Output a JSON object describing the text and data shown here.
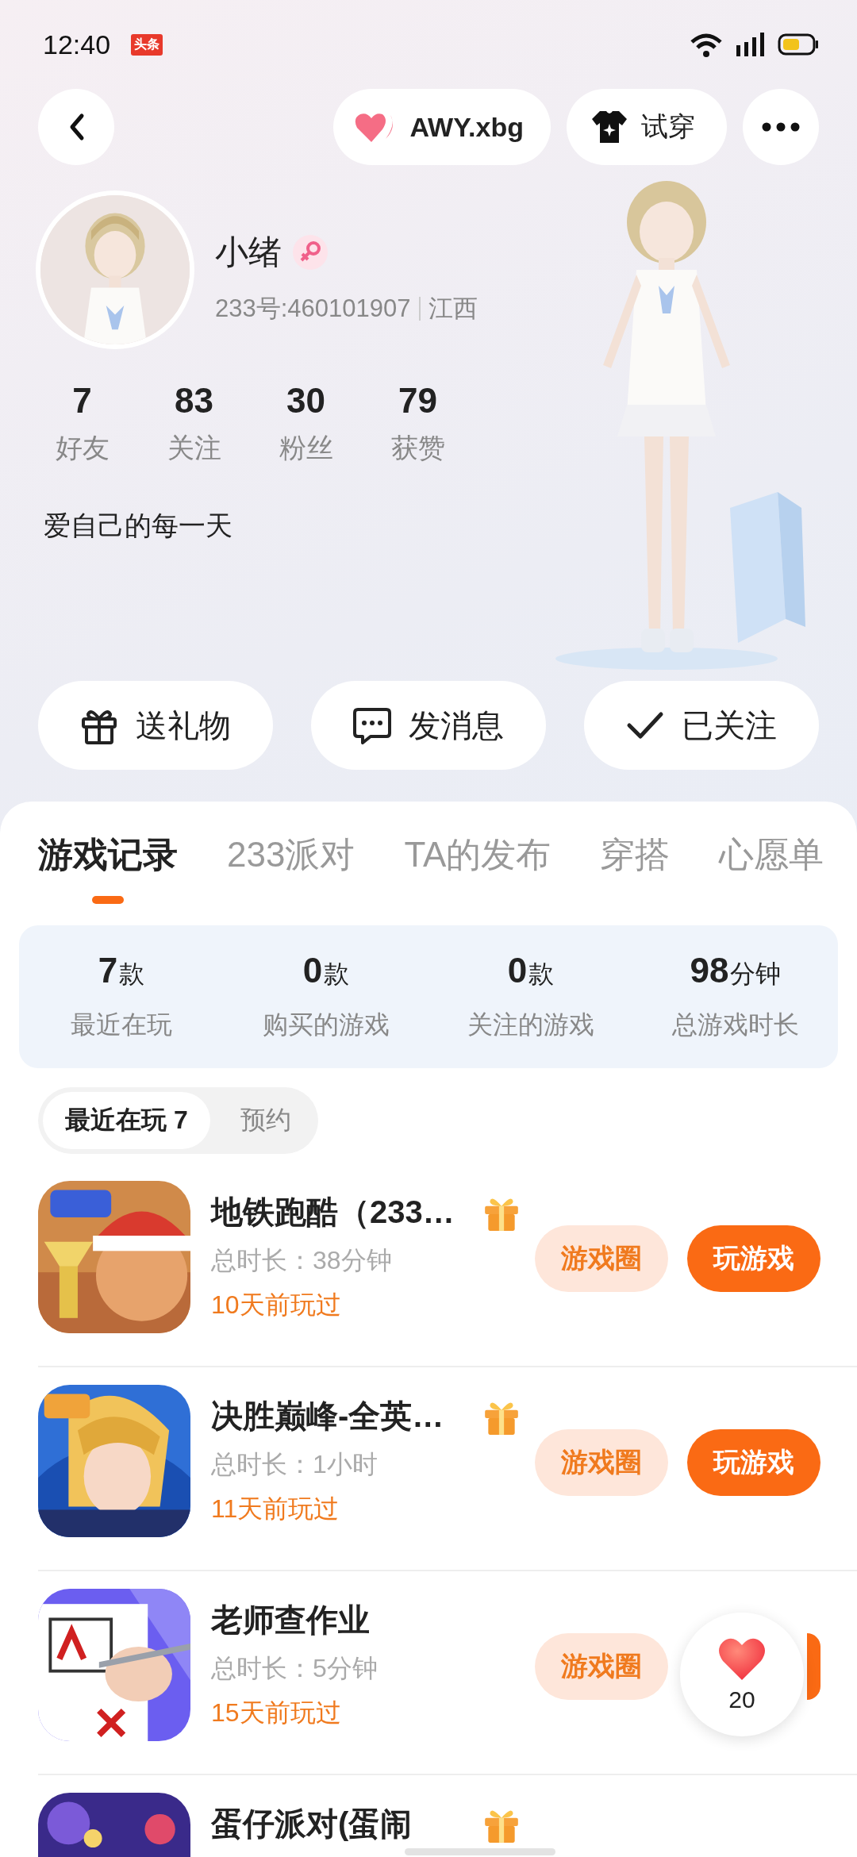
{
  "status_bar": {
    "time": "12:40",
    "notification_badge": "头条"
  },
  "top_bar": {
    "friend_chip": "AWY.xbg",
    "try_on_button": "试穿"
  },
  "profile": {
    "name": "小绪",
    "gender_badge": {
      "kind": "female"
    },
    "id_text": "233号:460101907",
    "region": "江西",
    "bio": "爱自己的每一天",
    "stats": [
      {
        "value": "7",
        "label": "好友"
      },
      {
        "value": "83",
        "label": "关注"
      },
      {
        "value": "30",
        "label": "粉丝"
      },
      {
        "value": "79",
        "label": "获赞"
      }
    ]
  },
  "actions": [
    {
      "kind": "gift",
      "label": "送礼物"
    },
    {
      "kind": "message",
      "label": "发消息"
    },
    {
      "kind": "followed",
      "label": "已关注"
    }
  ],
  "tabs": [
    {
      "label": "游戏记录",
      "selected": true
    },
    {
      "label": "233派对",
      "selected": false
    },
    {
      "label": "TA的发布",
      "selected": false
    },
    {
      "label": "穿搭",
      "selected": false
    },
    {
      "label": "心愿单",
      "selected": false
    }
  ],
  "summary": [
    {
      "value": "7",
      "unit": "款",
      "label": "最近在玩"
    },
    {
      "value": "0",
      "unit": "款",
      "label": "购买的游戏"
    },
    {
      "value": "0",
      "unit": "款",
      "label": "关注的游戏"
    },
    {
      "value": "98",
      "unit": "分钟",
      "label": "总游戏时长"
    }
  ],
  "filters": [
    {
      "label": "最近在玩 7",
      "selected": true
    },
    {
      "label": "预约",
      "selected": false
    }
  ],
  "games": [
    {
      "title": "地铁跑酷（233…",
      "gift": true,
      "duration": "总时长：38分钟",
      "last_played": "10天前玩过",
      "circle_button": "游戏圈",
      "play_button": "玩游戏"
    },
    {
      "title": "决胜巅峰-全英…",
      "gift": true,
      "duration": "总时长：1小时",
      "last_played": "11天前玩过",
      "circle_button": "游戏圈",
      "play_button": "玩游戏"
    },
    {
      "title": "老师查作业",
      "gift": false,
      "duration": "总时长：5分钟",
      "last_played": "15天前玩过",
      "circle_button": "游戏圈"
    },
    {
      "title": "蛋仔派对(蛋闹",
      "gift": true
    }
  ],
  "floating_like": {
    "count": "20"
  }
}
